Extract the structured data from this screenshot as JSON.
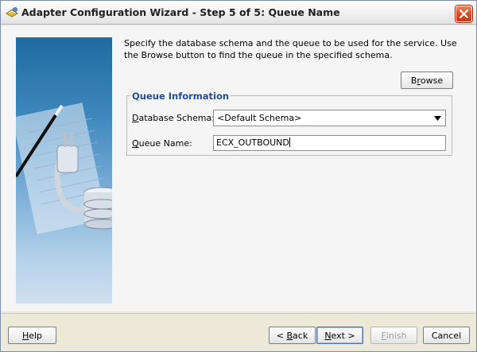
{
  "window": {
    "title": "Adapter Configuration Wizard - Step 5 of 5: Queue Name",
    "icon": "wizard-app-icon"
  },
  "instructions": "Specify the database schema and the queue to be used for the service. Use the Browse button to find the queue in the specified schema.",
  "browse_button": {
    "label": "Browse",
    "mnemonic": "r"
  },
  "queue_info": {
    "title": "Queue Information",
    "database_schema": {
      "label_pre": "",
      "label_mn": "D",
      "label_post": "atabase Schema:",
      "value": "<Default Schema>"
    },
    "queue_name": {
      "label_pre": "",
      "label_mn": "Q",
      "label_post": "ueue Name:",
      "value": "ECX_OUTBOUND"
    }
  },
  "buttons": {
    "help": {
      "pre": "",
      "mn": "H",
      "post": "elp"
    },
    "back": {
      "pre": "< ",
      "mn": "B",
      "post": "ack"
    },
    "next": {
      "pre": "",
      "mn": "N",
      "post": "ext >"
    },
    "finish": {
      "pre": "",
      "mn": "F",
      "post": "inish"
    },
    "cancel": {
      "label": "Cancel"
    }
  },
  "colors": {
    "group_title": "#1f4c9b",
    "close_button": "#d54a22"
  }
}
